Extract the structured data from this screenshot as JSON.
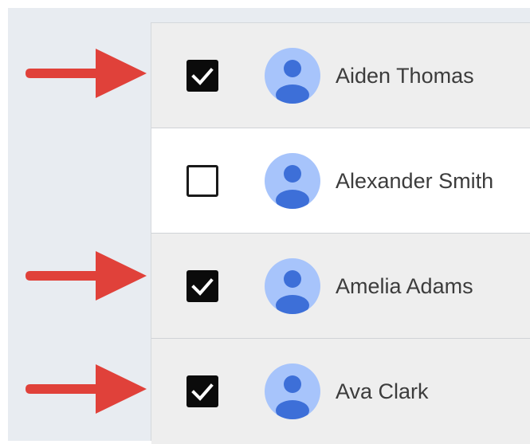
{
  "contacts": [
    {
      "name": "Aiden Thomas",
      "checked": true,
      "avatar_icon": "person-avatar-icon"
    },
    {
      "name": "Alexander Smith",
      "checked": false,
      "avatar_icon": "person-avatar-icon"
    },
    {
      "name": "Amelia Adams",
      "checked": true,
      "avatar_icon": "person-avatar-icon"
    },
    {
      "name": "Ava Clark",
      "checked": true,
      "avatar_icon": "person-avatar-icon"
    }
  ],
  "annotations": {
    "arrow_icon": "red-arrow-icon",
    "arrow_color": "#e0413a"
  },
  "colors": {
    "checked_row_bg": "#eeeeee",
    "unchecked_row_bg": "#ffffff",
    "avatar_bg": "#a7c4fb",
    "avatar_figure": "#3d6fd8",
    "page_bg": "#e8ecf1"
  }
}
